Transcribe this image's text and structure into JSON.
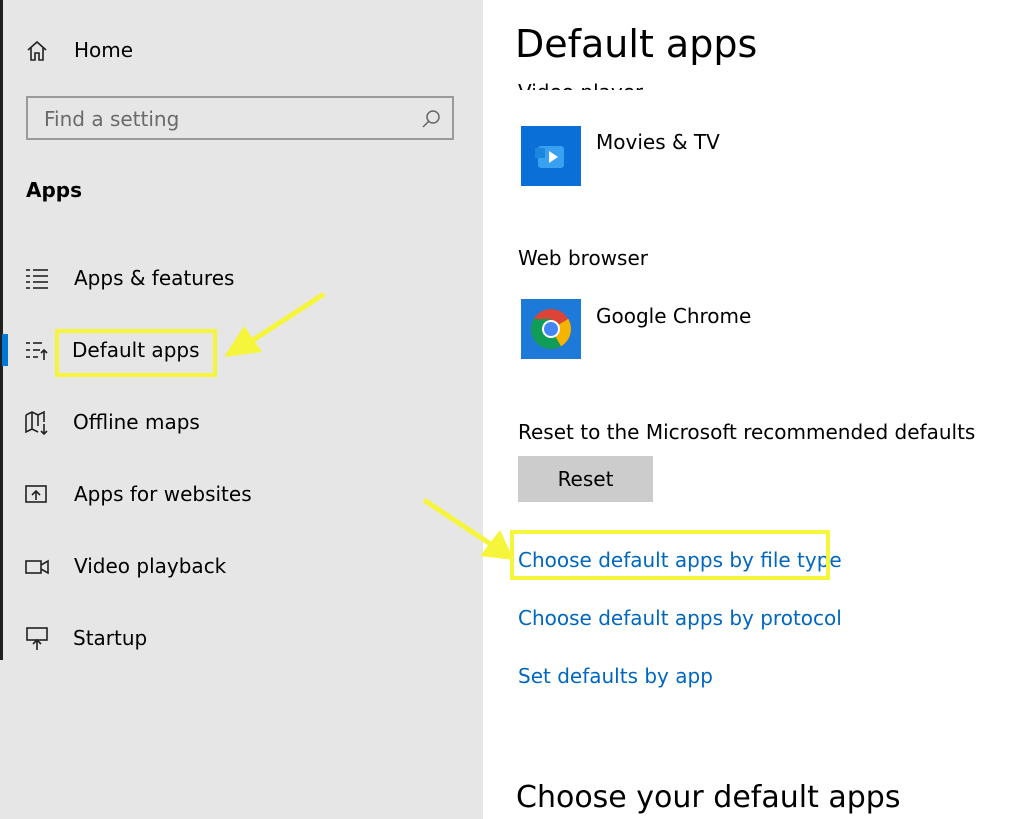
{
  "sidebar": {
    "home_label": "Home",
    "search_placeholder": "Find a setting",
    "section_title": "Apps",
    "items": [
      {
        "label": "Apps & features",
        "icon": "list-icon"
      },
      {
        "label": "Default apps",
        "icon": "default-apps-icon"
      },
      {
        "label": "Offline maps",
        "icon": "map-download-icon"
      },
      {
        "label": "Apps for websites",
        "icon": "open-link-icon"
      },
      {
        "label": "Video playback",
        "icon": "video-camera-icon"
      },
      {
        "label": "Startup",
        "icon": "startup-icon"
      }
    ],
    "selected_item": "Default apps"
  },
  "main": {
    "title": "Default apps",
    "video_player_label": "Video player",
    "video_player_app": "Movies & TV",
    "web_browser_label": "Web browser",
    "web_browser_app": "Google Chrome",
    "reset_label": "Reset to the Microsoft recommended defaults",
    "reset_button": "Reset",
    "links": [
      "Choose default apps by file type",
      "Choose default apps by protocol",
      "Set defaults by app"
    ],
    "bottom_heading": "Choose your default apps"
  },
  "colors": {
    "sidebar_bg": "#e6e6e6",
    "accent": "#0078d7",
    "link": "#0067c0",
    "highlight": "#f5f53c"
  }
}
